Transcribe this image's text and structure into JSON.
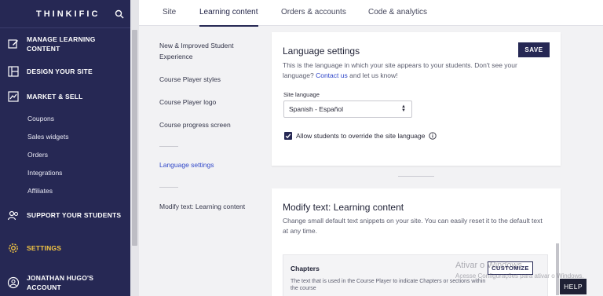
{
  "sidebar": {
    "brand": "THINKIFIC",
    "search_icon": "search-icon",
    "items": [
      {
        "label": "MANAGE LEARNING CONTENT",
        "icon": "edit-icon"
      },
      {
        "label": "DESIGN YOUR SITE",
        "icon": "layout-icon"
      },
      {
        "label": "MARKET & SELL",
        "icon": "chart-icon"
      },
      {
        "label": "SUPPORT YOUR STUDENTS",
        "icon": "users-icon"
      },
      {
        "label": "SETTINGS",
        "icon": "gear-icon"
      },
      {
        "label": "JONATHAN HUGO'S ACCOUNT",
        "icon": "account-icon"
      }
    ],
    "market_sub": [
      "Coupons",
      "Sales widgets",
      "Orders",
      "Integrations",
      "Affiliates"
    ],
    "active_color": "#f5c743",
    "bg_color": "#262854"
  },
  "tabs": [
    {
      "label": "Site"
    },
    {
      "label": "Learning content"
    },
    {
      "label": "Orders & accounts"
    },
    {
      "label": "Code & analytics"
    }
  ],
  "subnav": [
    "New & Improved Student Experience",
    "Course Player styles",
    "Course Player logo",
    "Course progress screen",
    "Language settings",
    "Modify text: Learning content"
  ],
  "language_card": {
    "title": "Language settings",
    "save_label": "SAVE",
    "desc_pre": "This is the language in which your site appears to your students. Don't see your language?",
    "desc_link": "Contact us",
    "desc_post": "and let us know!",
    "field_label": "Site language",
    "selected_language": "Spanish - Español",
    "checkbox_label": "Allow students to override the site language",
    "checkbox_checked": true
  },
  "modify_card": {
    "title": "Modify text: Learning content",
    "desc": "Change small default text snippets on your site. You can easily reset it to the default text at any time.",
    "section_title": "Chapters",
    "section_desc": "The text that is used in the Course Player to indicate Chapters or sections within the course",
    "customize_label": "CUSTOMIZE"
  },
  "watermark": {
    "line1": "Ativar o Windows",
    "line2": "Acesse Configurações para ativar o Windows."
  },
  "help_label": "HELP"
}
